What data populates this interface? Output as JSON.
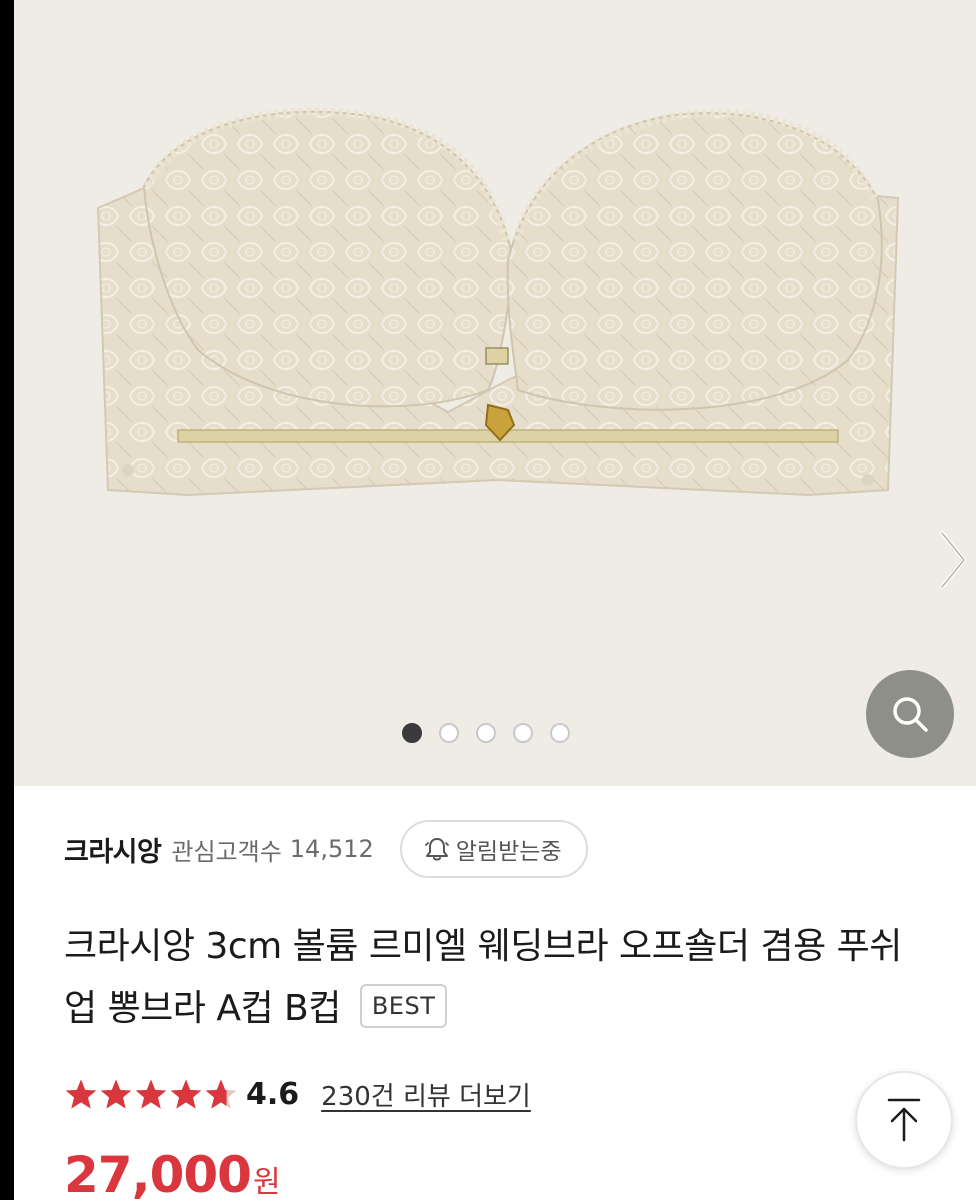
{
  "gallery": {
    "slide_count": 5,
    "active_slide": 1,
    "image": "strapless-lace-bra-product-photo",
    "icons": {
      "next": "chevron-right-icon",
      "zoom": "search-icon"
    }
  },
  "seller": {
    "name": "크라시앙",
    "fans_label": "관심고객수",
    "fans_count": "14,512",
    "alarm_label": "알림받는중",
    "alarm_icon": "bell-icon"
  },
  "product": {
    "title": "크라시앙 3cm 볼륨 르미엘 웨딩브라 오프숄더 겸용 푸쉬업 뽕브라 A컵 B컵",
    "badge": "BEST",
    "rating": "4.6",
    "rating_stars_value": 4.6,
    "review_link": "230건 리뷰 더보기",
    "price": "27,000",
    "price_unit": "원"
  },
  "floating": {
    "top_icon": "arrow-up-icon"
  },
  "colors": {
    "accent": "#d9363e",
    "star": "#d9363e",
    "gallery_bg": "#efece5",
    "zoom_bg": "#8f8f8a"
  }
}
